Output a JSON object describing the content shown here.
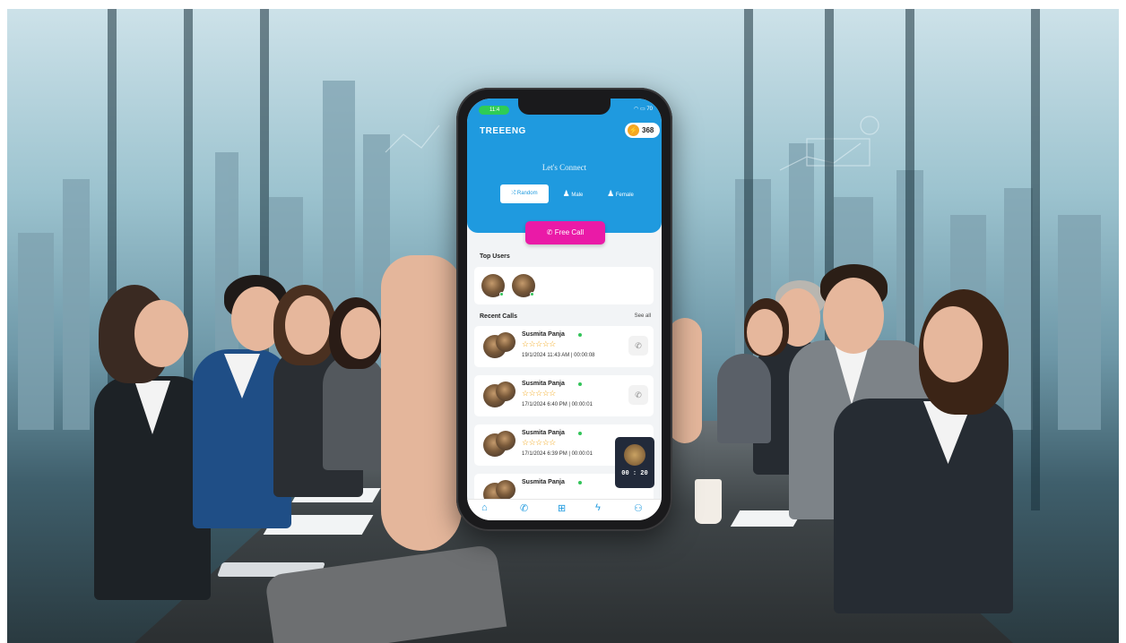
{
  "status_bar": {
    "time": "11:4",
    "battery": "70"
  },
  "app": {
    "name": "TREEENG",
    "coins": "368"
  },
  "header": {
    "subtitle": "Let's Connect"
  },
  "gender_tabs": [
    {
      "icon": "shuffle-icon",
      "label": "Random",
      "selected": true
    },
    {
      "icon": "male-icon",
      "label": "Male",
      "selected": false
    },
    {
      "icon": "female-icon",
      "label": "Female",
      "selected": false
    }
  ],
  "free_call_label": "Free Call",
  "top_users": {
    "title": "Top Users",
    "count": 2
  },
  "recent_calls": {
    "title": "Recent Calls",
    "see_all": "See all",
    "items": [
      {
        "name": "Susmita Panja",
        "stars": "☆☆☆☆☆",
        "datetime": "19/1/2024 11:43 AM | 00:00:08"
      },
      {
        "name": "Susmita Panja",
        "stars": "☆☆☆☆☆",
        "datetime": "17/1/2024 6:40 PM | 00:00:01"
      },
      {
        "name": "Susmita Panja",
        "stars": "☆☆☆☆☆",
        "datetime": "17/1/2024 6:39 PM | 00:00:01"
      },
      {
        "name": "Susmita Panja",
        "stars": "",
        "datetime": ""
      }
    ]
  },
  "pip_timer": "00 : 20",
  "bottom_nav": [
    {
      "icon": "home-icon",
      "active": true
    },
    {
      "icon": "call-log-icon",
      "active": false
    },
    {
      "icon": "gift-icon",
      "active": false
    },
    {
      "icon": "lightning-icon",
      "active": false
    },
    {
      "icon": "profile-icon",
      "active": false
    }
  ],
  "colors": {
    "primary": "#1f9adf",
    "accent": "#ea1aa7",
    "online": "#33c45a",
    "star": "#f2a81d",
    "coin": "#f5a623"
  }
}
